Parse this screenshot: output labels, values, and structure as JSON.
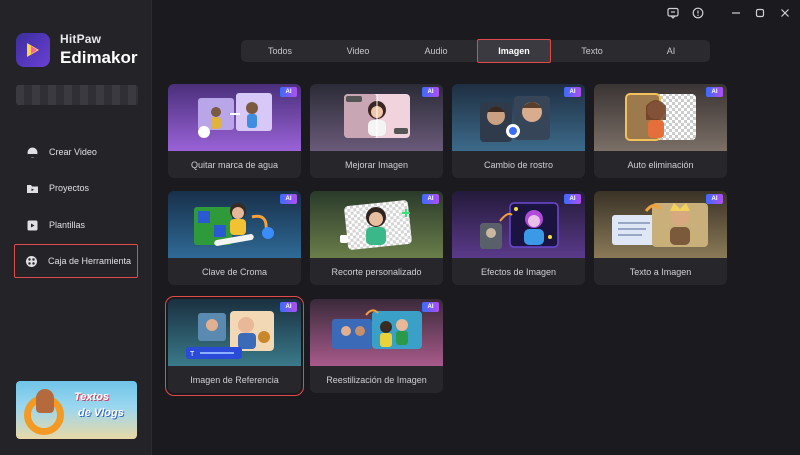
{
  "brand": {
    "top": "HitPaw",
    "main": "Edimakor"
  },
  "sidebar": {
    "items": [
      {
        "label": "Crear Video",
        "icon": "create-video-icon"
      },
      {
        "label": "Proyectos",
        "icon": "folder-icon"
      },
      {
        "label": "Plantillas",
        "icon": "template-icon"
      },
      {
        "label": "Caja de Herramienta",
        "icon": "toolbox-icon",
        "active": true
      }
    ],
    "promo": {
      "line1": "Textos",
      "line2": "de Vlogs"
    }
  },
  "window": {
    "icons": [
      "feedback-icon",
      "settings-icon",
      "minimize-icon",
      "maximize-icon",
      "close-icon"
    ]
  },
  "tabs": [
    {
      "label": "Todos"
    },
    {
      "label": "Video"
    },
    {
      "label": "Audio"
    },
    {
      "label": "Imagen",
      "active": true
    },
    {
      "label": "Texto"
    },
    {
      "label": "AI"
    }
  ],
  "badge": "AI",
  "cards": [
    {
      "label": "Quitar marca de agua"
    },
    {
      "label": "Mejorar Imagen"
    },
    {
      "label": "Cambio de rostro"
    },
    {
      "label": "Auto eliminación"
    },
    {
      "label": "Clave de Croma"
    },
    {
      "label": "Recorte personalizado"
    },
    {
      "label": "Efectos de Imagen"
    },
    {
      "label": "Texto a Imagen"
    },
    {
      "label": "Imagen de Referencia",
      "selected": true
    },
    {
      "label": "Reestilización de Imagen"
    }
  ],
  "colors": {
    "accent": "#e24a4a",
    "bg": "#1b1b1f",
    "sidebar": "#232328",
    "ai_badge_start": "#3a6cff",
    "ai_badge_end": "#b34df0"
  }
}
